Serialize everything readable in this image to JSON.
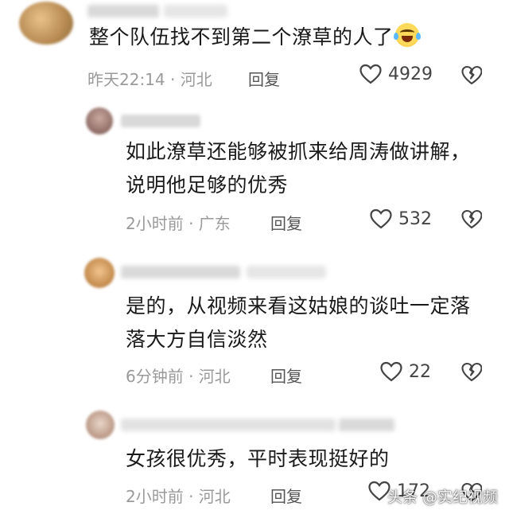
{
  "comments": [
    {
      "text_lines": [
        "整个队伍找不到第二个潦草的人了"
      ],
      "emoji": "crying-laughing-emoji",
      "time": "昨天22:14 · 河北",
      "reply_label": "回复",
      "likes": "4929"
    },
    {
      "name_partial": "m小白呀",
      "text_lines": [
        "如此潦草还能够被抓来给周涛做讲解，",
        "说明他足够的优秀"
      ],
      "time": "2小时前 · 广东",
      "reply_label": "回复",
      "likes": "532"
    },
    {
      "name_partial": "m小白呀",
      "text_lines": [
        "是的，从视频来看这姑娘的谈吐一定落",
        "落大方自信淡然"
      ],
      "time": "6分钟前 · 河北",
      "reply_label": "回复",
      "likes": "22"
    },
    {
      "name_partial": "叫前鸟",
      "text_lines": [
        "女孩很优秀，平时表现挺好的"
      ],
      "time": "2小时前 · 河北",
      "reply_label": "回复",
      "likes": "172"
    }
  ],
  "watermark": "头条 @实纪视频",
  "icons": {
    "like": "heart-outline-icon",
    "dislike": "broken-heart-icon"
  }
}
